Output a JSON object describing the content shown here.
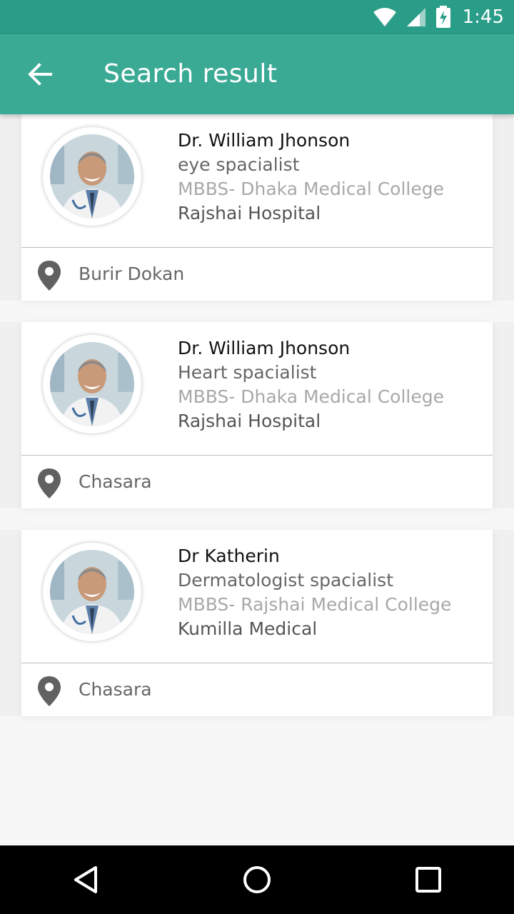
{
  "status_bar": {
    "time": "1:45",
    "icons": [
      "wifi-icon",
      "signal-icon",
      "battery-charging-icon"
    ]
  },
  "app_bar": {
    "title": "Search result",
    "back_icon": "arrow-back-icon"
  },
  "results": [
    {
      "name": "Dr. William Jhonson",
      "speciality": "eye spacialist",
      "degree": "MBBS- Dhaka Medical College",
      "hospital": "Rajshai Hospital",
      "location": "Burir Dokan"
    },
    {
      "name": "Dr. William Jhonson",
      "speciality": "Heart spacialist",
      "degree": "MBBS- Dhaka Medical College",
      "hospital": "Rajshai Hospital",
      "location": "Chasara"
    },
    {
      "name": "Dr Katherin",
      "speciality": "Dermatologist spacialist",
      "degree": "MBBS- Rajshai Medical College",
      "hospital": "Kumilla Medical",
      "location": "Chasara"
    }
  ],
  "nav_bar": {
    "icons": [
      "back-triangle-icon",
      "home-circle-icon",
      "recents-square-icon"
    ]
  },
  "colors": {
    "status_bar": "#2a9d88",
    "app_bar": "#3aaa95",
    "background": "#f7f7f7"
  }
}
